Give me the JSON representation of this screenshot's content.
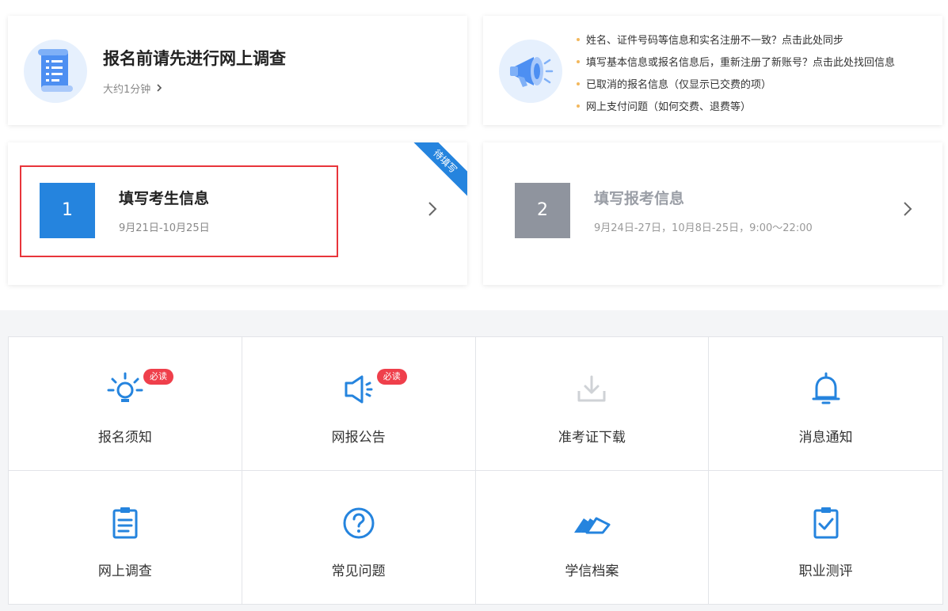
{
  "survey": {
    "title": "报名前请先进行网上调查",
    "subtitle": "大约1分钟",
    "icon": "scroll-document-icon"
  },
  "notices": {
    "icon": "megaphone-icon",
    "items": [
      "姓名、证件号码等信息和实名注册不一致？点击此处同步",
      "填写基本信息或报名信息后，重新注册了新账号？点击此处找回信息",
      "已取消的报名信息（仅显示已交费的项）",
      "网上支付问题（如何交费、退费等）"
    ]
  },
  "steps": [
    {
      "number": "1",
      "title": "填写考生信息",
      "date": "9月21日-10月25日",
      "ribbon": "待填写",
      "color": "#2584de"
    },
    {
      "number": "2",
      "title": "填写报考信息",
      "date": "9月24日-27日，10月8日-25日，9:00～22:00",
      "color": "#8f949e"
    }
  ],
  "grid": {
    "items": [
      {
        "label": "报名须知",
        "icon": "lightbulb-icon",
        "badge": "必读"
      },
      {
        "label": "网报公告",
        "icon": "speaker-icon",
        "badge": "必读"
      },
      {
        "label": "准考证下载",
        "icon": "download-icon"
      },
      {
        "label": "消息通知",
        "icon": "bell-icon"
      },
      {
        "label": "网上调查",
        "icon": "clipboard-list-icon"
      },
      {
        "label": "常见问题",
        "icon": "question-circle-icon"
      },
      {
        "label": "学信档案",
        "icon": "files-stack-icon"
      },
      {
        "label": "职业测评",
        "icon": "clipboard-check-icon"
      }
    ]
  },
  "colors": {
    "accent": "#2584de",
    "badge": "#ef3f4b",
    "highlight_border": "#e8353b",
    "disabled_icon": "#cfd2d6",
    "step_inactive": "#8f949e"
  }
}
